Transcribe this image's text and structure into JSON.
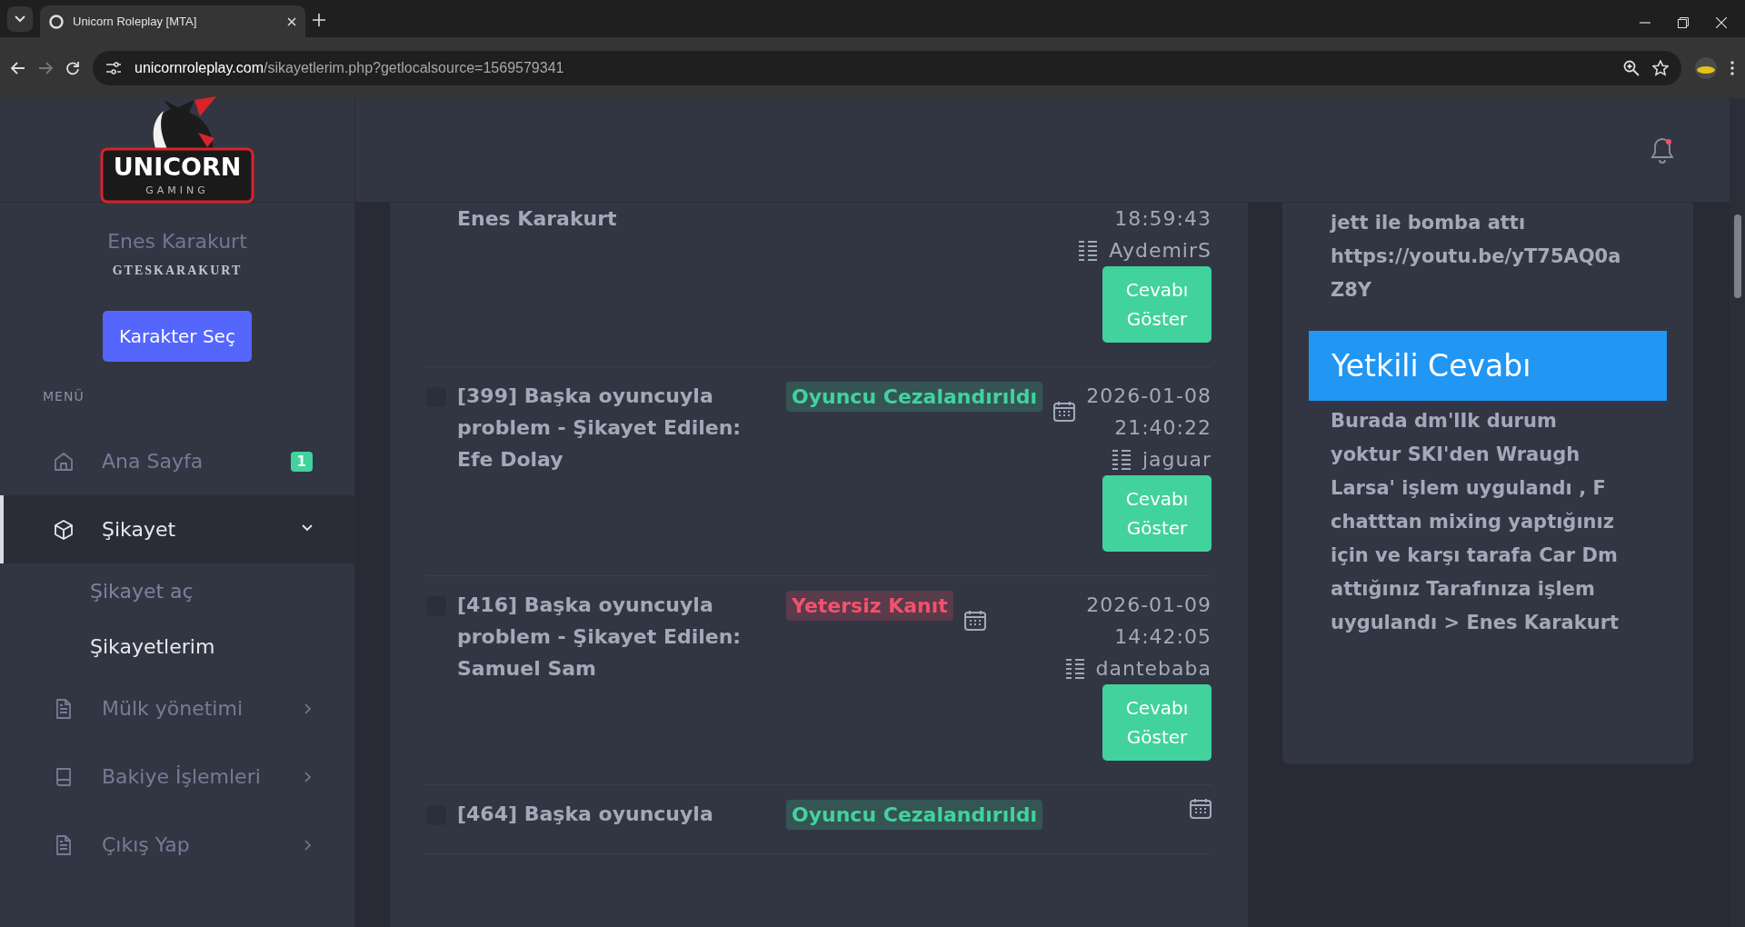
{
  "browser": {
    "tab_title": "Unicorn Roleplay [MTA]",
    "url_host": "unicornroleplay.com",
    "url_path": "/sikayetlerim.php?getlocalsource=1569579341"
  },
  "logo": {
    "wordmark": "UNICORN",
    "tagline": "GAMING"
  },
  "sidebar": {
    "user_name": "Enes Karakurt",
    "account": "GTESKARAKURT",
    "character_button": "Karakter Seç",
    "menu_heading": "MENÜ",
    "items": [
      {
        "label": "Ana Sayfa",
        "kind": "link",
        "selected": false,
        "badge": "1"
      },
      {
        "label": "Şikayet",
        "kind": "group",
        "selected": true,
        "expanded": true,
        "children": [
          {
            "label": "Şikayet aç",
            "selected": false
          },
          {
            "label": "Şikayetlerim",
            "selected": true
          }
        ]
      },
      {
        "label": "Mülk yönetimi",
        "kind": "group",
        "selected": false,
        "expanded": false
      },
      {
        "label": "Bakiye İşlemleri",
        "kind": "group",
        "selected": false,
        "expanded": false
      },
      {
        "label": "Çıkış Yap",
        "kind": "group",
        "selected": false,
        "expanded": false
      }
    ]
  },
  "complaints": [
    {
      "title": "Enes Karakurt",
      "date": "18:59:43",
      "handler": "AydemirS",
      "button": "Cevabı Göster"
    },
    {
      "title": "[399] Başka oyuncuyla problem - Şikayet Edilen: Efe Dolay",
      "checked": false,
      "status": {
        "text": "Oyuncu Cezalandırıldı",
        "kind": "success"
      },
      "date": "2026-01-08 21:40:22",
      "date_icon": true,
      "handler": "jaguar",
      "button": "Cevabı Göster"
    },
    {
      "title": "[416] Başka oyuncuyla problem - Şikayet Edilen: Samuel Sam",
      "checked": false,
      "status": {
        "text": "Yetersiz Kanıt",
        "kind": "danger"
      },
      "date": "2026-01-09 14:42:05",
      "date_icon": true,
      "handler": "dantebaba",
      "button": "Cevabı Göster"
    },
    {
      "title": "[464] Başka oyuncuyla",
      "checked": false,
      "status": {
        "text": "Oyuncu Cezalandırıldı",
        "kind": "success"
      },
      "date_icon": true
    }
  ],
  "detail": {
    "complaint_text": "jett ile bomba attı https://youtu.be/yT75AQ0aZ8Y",
    "answer_heading": "Yetkili Cevabı",
    "answer_text": "Burada dm'lIk durum yoktur SKI'den Wraugh Larsa' işlem uygulandı , F chatttan mixing yaptığınız için ve karşı tarafa Car Dm attığınız Tarafınıza işlem uygulandı > Enes Karakurt"
  }
}
